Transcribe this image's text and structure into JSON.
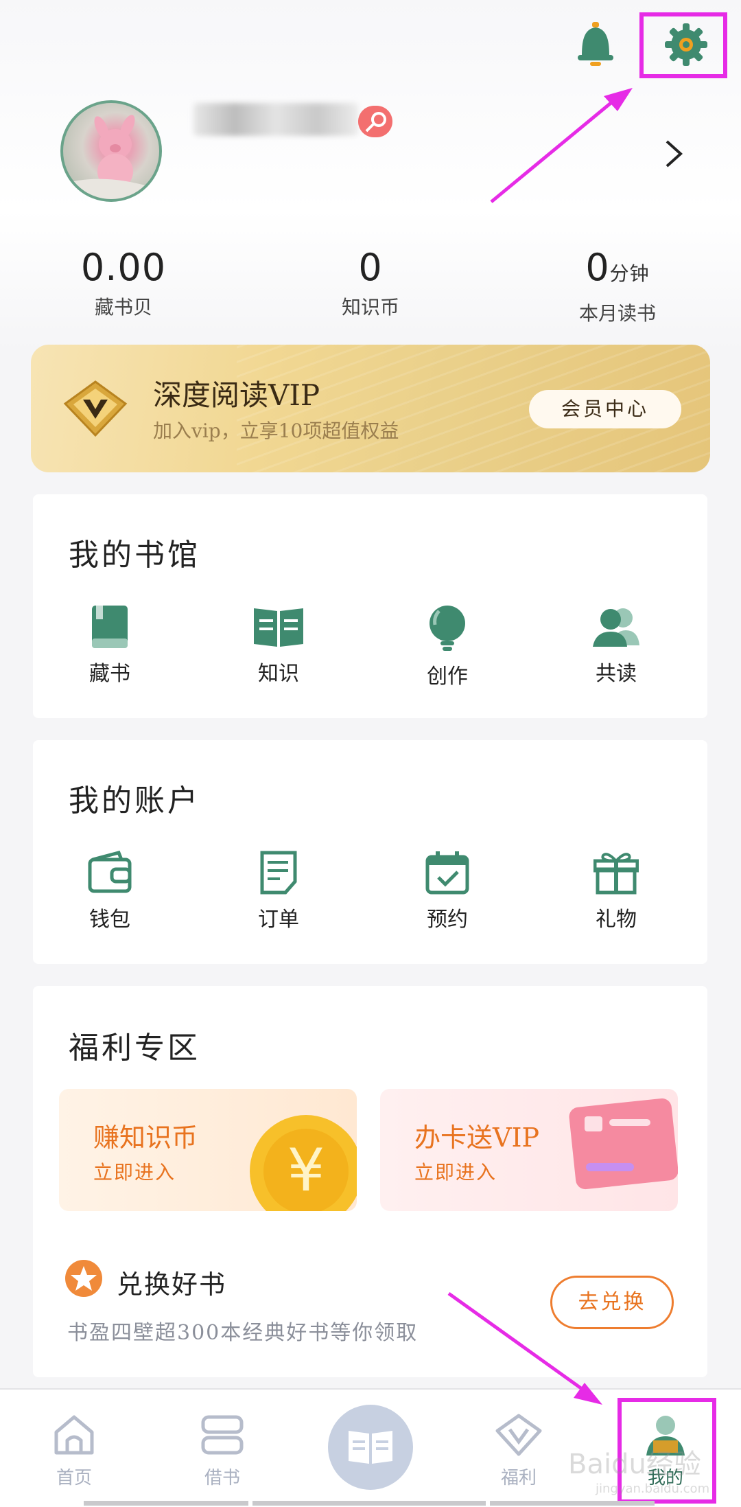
{
  "colors": {
    "accent_green": "#3f8a6f",
    "highlight_magenta": "#e62be6",
    "orange": "#ee7d2f",
    "vip_gold": "#efd693"
  },
  "header": {
    "bell_icon": "bell-icon",
    "settings_icon": "gear-icon"
  },
  "profile": {
    "stats": [
      {
        "value": "0.00",
        "unit": "",
        "label": "藏书贝"
      },
      {
        "value": "0",
        "unit": "",
        "label": "知识币"
      },
      {
        "value": "0",
        "unit": "分钟",
        "label": "本月读书"
      }
    ]
  },
  "vip": {
    "title": "深度阅读VIP",
    "subtitle": "加入vip，立享10项超值权益",
    "button": "会员中心"
  },
  "library": {
    "title": "我的书馆",
    "items": [
      {
        "label": "藏书",
        "icon": "book-icon"
      },
      {
        "label": "知识",
        "icon": "open-book-icon"
      },
      {
        "label": "创作",
        "icon": "lightbulb-icon"
      },
      {
        "label": "共读",
        "icon": "users-icon"
      }
    ]
  },
  "account": {
    "title": "我的账户",
    "items": [
      {
        "label": "钱包",
        "icon": "wallet-icon"
      },
      {
        "label": "订单",
        "icon": "order-icon"
      },
      {
        "label": "预约",
        "icon": "calendar-check-icon"
      },
      {
        "label": "礼物",
        "icon": "gift-icon"
      }
    ]
  },
  "welfare": {
    "title": "福利专区",
    "promos": [
      {
        "title": "赚知识币",
        "subtitle": "立即进入"
      },
      {
        "title": "办卡送VIP",
        "subtitle": "立即进入"
      }
    ],
    "exchange": {
      "title": "兑换好书",
      "subtitle": "书盈四壁超300本经典好书等你领取",
      "button": "去兑换"
    }
  },
  "tabbar": {
    "tabs": [
      {
        "label": "首页",
        "icon": "home-icon"
      },
      {
        "label": "借书",
        "icon": "stack-icon"
      },
      {
        "label": "",
        "icon": "book-open-icon"
      },
      {
        "label": "福利",
        "icon": "diamond-v-icon"
      },
      {
        "label": "我的",
        "icon": "profile-icon"
      }
    ]
  },
  "watermark": {
    "text": "Baidu经验",
    "sub": "jingyan.baidu.com"
  }
}
